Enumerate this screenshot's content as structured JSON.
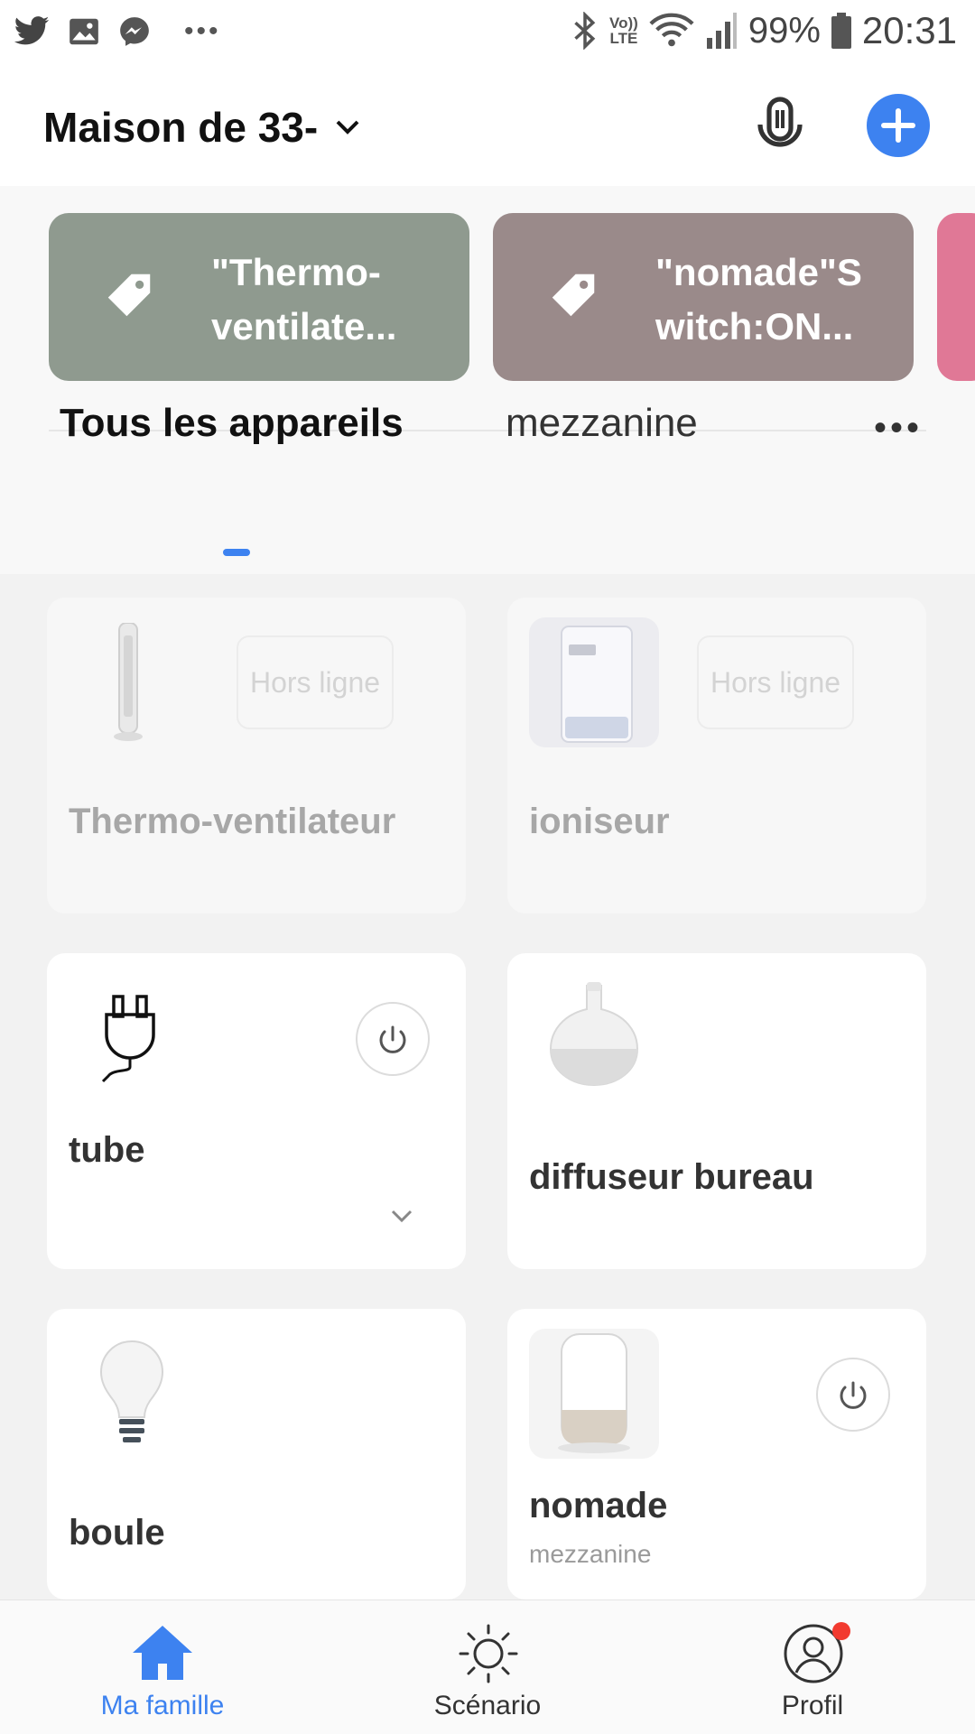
{
  "status_bar": {
    "volte_top": "Vo))",
    "volte_bottom": "LTE",
    "battery": "99%",
    "time": "20:31",
    "icons": [
      "twitter-icon",
      "gallery-icon",
      "messenger-icon",
      "more-icon",
      "bluetooth-icon",
      "wifi-icon",
      "signal-icon",
      "battery-icon"
    ]
  },
  "header": {
    "home_name": "Maison de 33-",
    "icons": [
      "chevron-down-icon",
      "microphone-icon",
      "add-icon"
    ],
    "accent_color": "#3d82f0"
  },
  "scenes": [
    {
      "label": "\"Thermo-ventilate...",
      "line1": "\"Thermo-",
      "line2": "ventilate...",
      "color": "#8f9a8f"
    },
    {
      "label": "\"nomade\"Switch:ON...",
      "line1": "\"nomade\"S",
      "line2": "witch:ON...",
      "color": "#9a8a8a"
    },
    {
      "label": "",
      "line1": "",
      "line2": "",
      "color": "#e07896"
    }
  ],
  "tabs": {
    "all_devices": "Tous les appareils",
    "room": "mezzanine",
    "more": "•••"
  },
  "devices": [
    {
      "name": "Thermo-ventilateur",
      "status": "Hors ligne",
      "icon": "tower-heater-icon"
    },
    {
      "name": "ioniseur",
      "status": "Hors ligne",
      "icon": "air-purifier-icon"
    },
    {
      "name": "tube",
      "icon": "plug-icon"
    },
    {
      "name": "diffuseur bureau",
      "icon": "diffuser-icon"
    },
    {
      "name": "boule",
      "icon": "light-bulb-icon"
    },
    {
      "name": "nomade",
      "room": "mezzanine",
      "icon": "speaker-diffuser-icon"
    }
  ],
  "bottom_nav": [
    {
      "label": "Ma famille",
      "icon": "home-icon",
      "active": true
    },
    {
      "label": "Scénario",
      "icon": "sun-icon",
      "active": false
    },
    {
      "label": "Profil",
      "icon": "profile-icon",
      "active": false,
      "notification_badge": true
    }
  ]
}
